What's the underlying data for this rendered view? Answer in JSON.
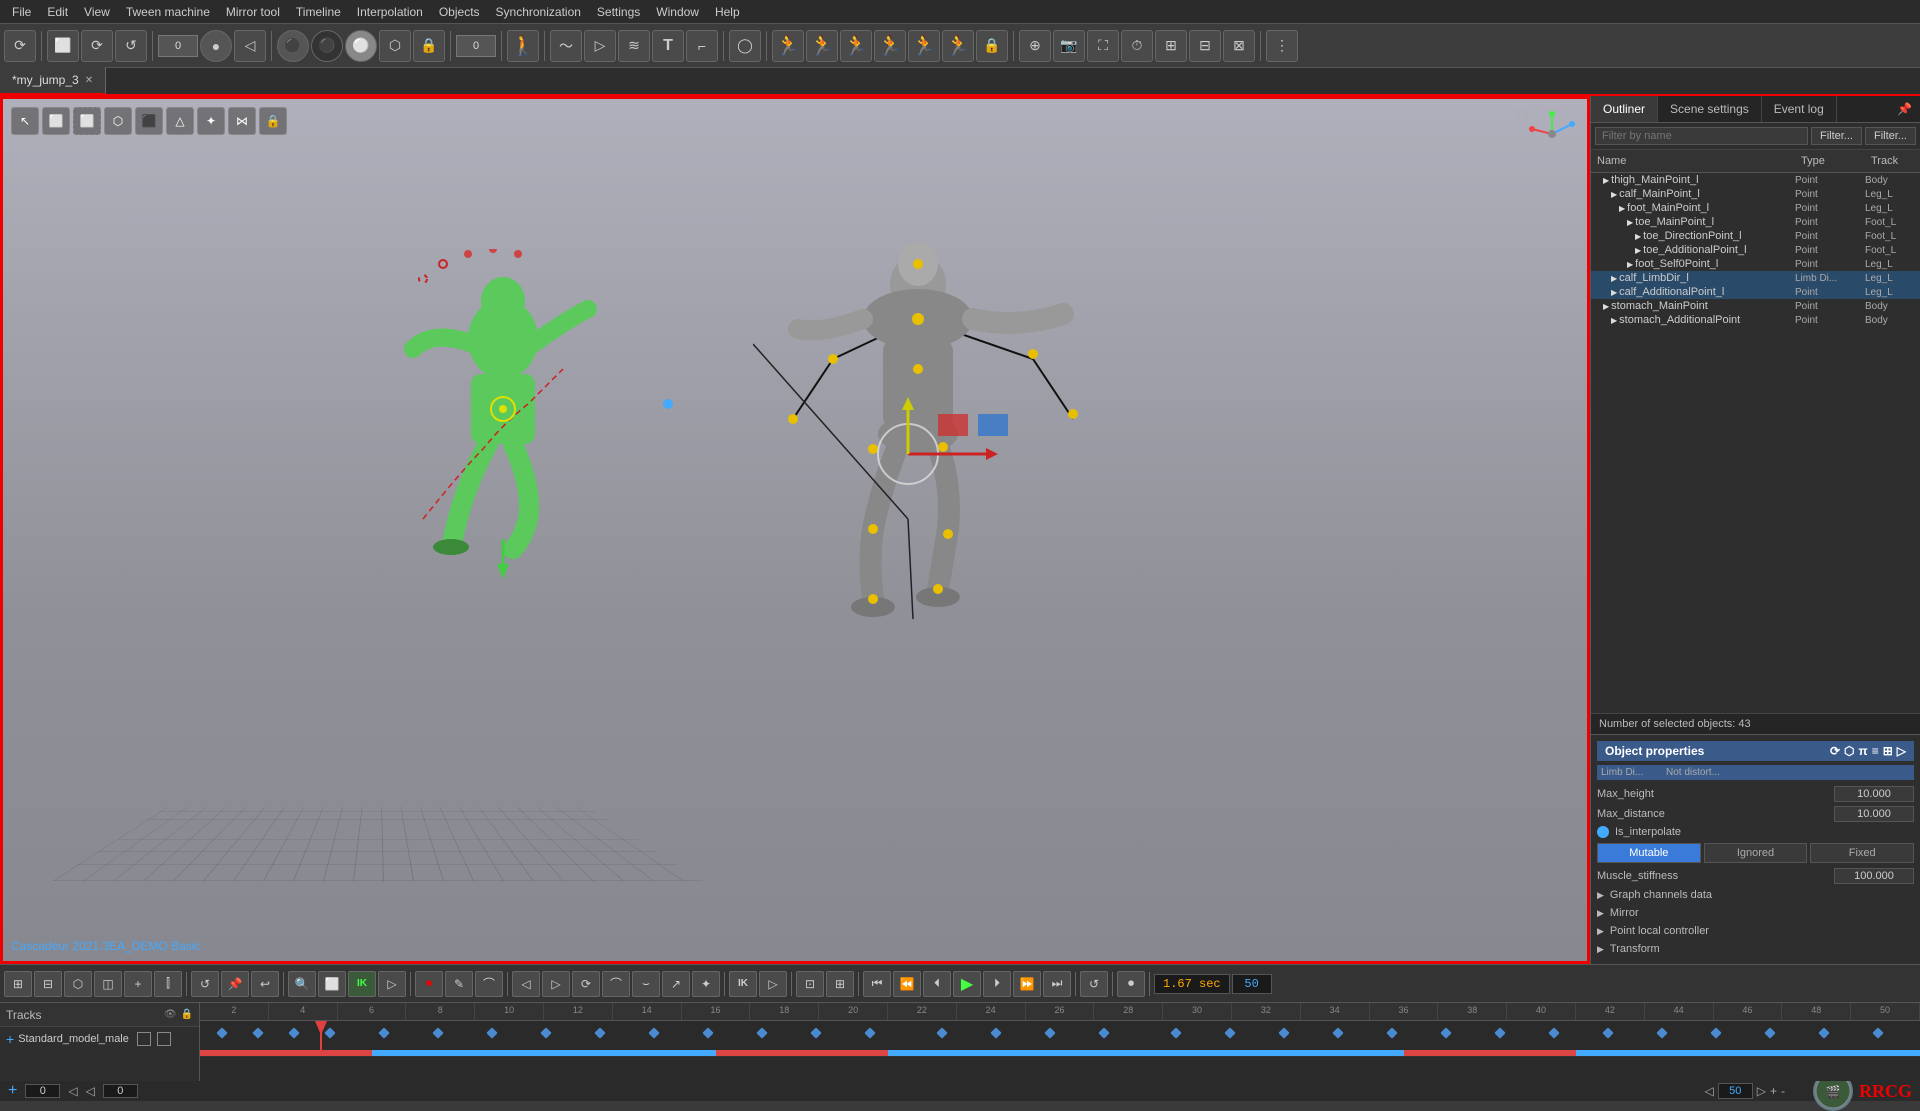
{
  "menu": {
    "items": [
      "File",
      "Edit",
      "View",
      "Tween machine",
      "Mirror tool",
      "Timeline",
      "Interpolation",
      "Objects",
      "Synchronization",
      "Settings",
      "Window",
      "Help"
    ]
  },
  "tabs": [
    {
      "label": "*my_jump_3",
      "active": true
    }
  ],
  "panel": {
    "tabs": [
      "Outliner",
      "Scene settings",
      "Event log"
    ],
    "filter_placeholder": "Filter by name",
    "filter_btn1": "Filter...",
    "filter_btn2": "Filter...",
    "columns": {
      "name": "Name",
      "type": "Type",
      "track": "Track"
    },
    "outliner_items": [
      {
        "indent": 12,
        "name": "thigh_MainPoint_l",
        "type": "Point",
        "track": "Body",
        "expanded": false
      },
      {
        "indent": 20,
        "name": "calf_MainPoint_l",
        "type": "Point",
        "track": "Leg_L",
        "expanded": false
      },
      {
        "indent": 28,
        "name": "foot_MainPoint_l",
        "type": "Point",
        "track": "Leg_L",
        "expanded": false
      },
      {
        "indent": 36,
        "name": "toe_MainPoint_l",
        "type": "Point",
        "track": "Foot_L",
        "expanded": false
      },
      {
        "indent": 44,
        "name": "toe_DirectionPoint_l",
        "type": "Point",
        "track": "Foot_L",
        "expanded": false
      },
      {
        "indent": 44,
        "name": "toe_AdditionalPoint_l",
        "type": "Point",
        "track": "Foot_L",
        "expanded": false
      },
      {
        "indent": 36,
        "name": "foot_Self0Point_l",
        "type": "Point",
        "track": "Leg_L",
        "expanded": false
      },
      {
        "indent": 20,
        "name": "calf_LimbDir_l",
        "type": "Limb Di...",
        "track": "Leg_L",
        "selected": true,
        "expanded": false
      },
      {
        "indent": 20,
        "name": "calf_AdditionalPoint_l",
        "type": "Point",
        "track": "Leg_L",
        "selected": true,
        "expanded": false
      },
      {
        "indent": 12,
        "name": "stomach_MainPoint",
        "type": "Point",
        "track": "Body",
        "expanded": false
      },
      {
        "indent": 20,
        "name": "stomach_AdditionalPoint",
        "type": "Point",
        "track": "Body",
        "expanded": false
      }
    ]
  },
  "object_properties": {
    "title": "Object properties",
    "max_height_label": "Max_height",
    "max_height_value": "10.000",
    "max_distance_label": "Max_distance",
    "max_distance_value": "10.000",
    "is_interpolate_label": "Is_interpolate",
    "mutable_label": "Mutable",
    "ignored_label": "Ignored",
    "fixed_label": "Fixed",
    "muscle_stiffness_label": "Muscle_stiffness",
    "muscle_stiffness_value": "100.000",
    "sections": [
      "Graph channels data",
      "Mirror",
      "Point local controller",
      "Transform"
    ]
  },
  "status_bar": {
    "selected_count": "Number of selected objects: 43"
  },
  "timeline": {
    "tracks_label": "Tracks",
    "track_name": "Standard_model_male",
    "time_display": "1.67 sec",
    "frame_counter": "50",
    "ruler_marks": [
      "2",
      "4",
      "6",
      "8",
      "10",
      "12",
      "14",
      "16",
      "18",
      "20",
      "22",
      "24",
      "26",
      "28",
      "30",
      "32",
      "34",
      "36",
      "38",
      "40",
      "42",
      "44",
      "46",
      "48",
      "50"
    ],
    "bottom_left_0": "0",
    "bottom_right_0": "0",
    "frame_end": "50"
  },
  "viewport": {
    "watermark": "RRCG",
    "cascadeur_label": "Cascadeur 2021.3EA_DEMO Basic"
  },
  "toolbar": {
    "buttons": [
      "◀",
      "▶",
      "↺",
      "○",
      "◉",
      "●",
      "◆",
      "⬟",
      "⬡",
      "🔒",
      "0",
      "▶▶"
    ]
  }
}
